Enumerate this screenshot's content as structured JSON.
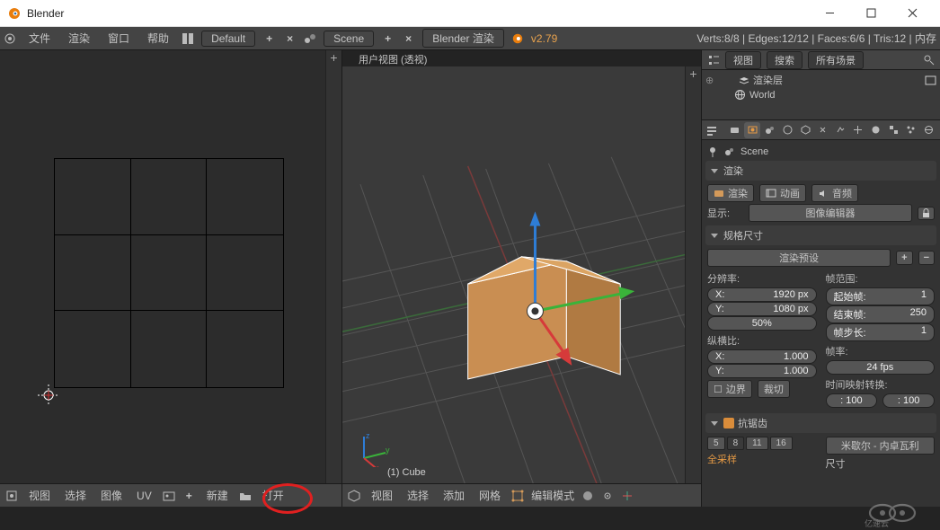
{
  "window": {
    "title": "Blender"
  },
  "topbar": {
    "menus": [
      "文件",
      "渲染",
      "窗口",
      "帮助"
    ],
    "layout": "Default",
    "scene": "Scene",
    "engine": "Blender 渲染",
    "version": "v2.79",
    "verts": "Verts:8/8",
    "edges": "Edges:12/12",
    "faces": "Faces:6/6",
    "tris": "Tris:12",
    "mem": "内存"
  },
  "viewport3d": {
    "header": "用户视图 (透视)",
    "object": "(1) Cube",
    "footer_menus": [
      "视图",
      "选择",
      "添加",
      "网格"
    ],
    "mode": "编辑模式"
  },
  "uveditor": {
    "footer_menus": [
      "视图",
      "选择",
      "图像",
      "UV"
    ],
    "new": "新建",
    "open": "打开"
  },
  "outliner": {
    "tabs": [
      "视图",
      "搜索",
      "所有场景"
    ],
    "items": [
      {
        "indent": 28,
        "icon": "layers",
        "label": "渲染层",
        "trailing": true
      },
      {
        "indent": 28,
        "icon": "world",
        "label": "World",
        "trailing": false
      }
    ]
  },
  "properties": {
    "context_title": "Scene",
    "panel_render": {
      "title": "渲染",
      "render_btn": "渲染",
      "anim_btn": "动画",
      "audio_btn": "音频",
      "display_label": "显示:",
      "display_value": "图像编辑器"
    },
    "panel_dims": {
      "title": "规格尺寸",
      "preset": "渲染预设",
      "res_label": "分辨率:",
      "res_x_label": "X:",
      "res_x": "1920 px",
      "res_y_label": "Y:",
      "res_y": "1080 px",
      "res_pct": "50%",
      "aspect_label": "纵横比:",
      "asp_x_label": "X:",
      "asp_x": "1.000",
      "asp_y_label": "Y:",
      "asp_y": "1.000",
      "border": "边界",
      "crop": "裁切",
      "framerange": "帧范围:",
      "start_label": "起始帧:",
      "start": "1",
      "end_label": "结束帧:",
      "end": "250",
      "step_label": "帧步长:",
      "step": "1",
      "fps_label": "帧率:",
      "fps": "24 fps",
      "remap_label": "时间映射转换:",
      "remap_a": ": 100",
      "remap_b": ": 100"
    },
    "panel_aa": {
      "title": "抗锯齿",
      "samples": [
        "5",
        "8",
        "11",
        "16"
      ],
      "sample_sel": "8",
      "aa_type": "米歇尔 - 内卓瓦利",
      "full": "全采样",
      "size": "尺寸"
    }
  }
}
